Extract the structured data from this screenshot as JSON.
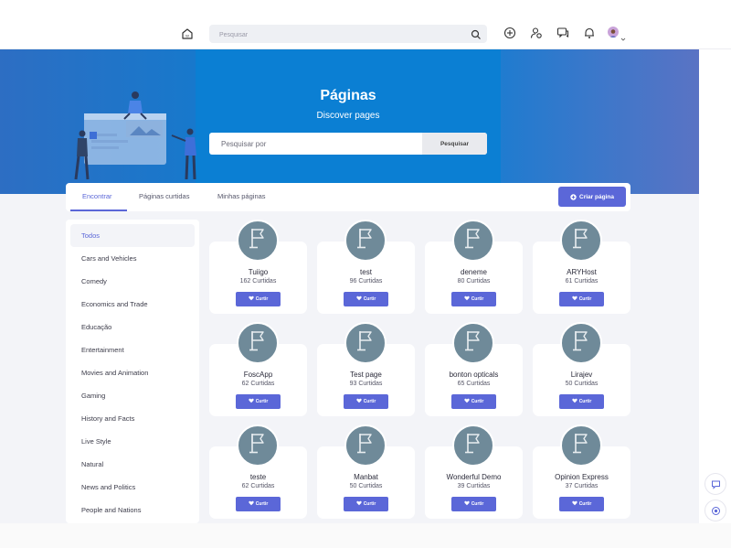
{
  "topbar": {
    "search_placeholder": "Pesquisar",
    "icons": [
      "home-icon",
      "search-icon",
      "plus-circle-icon",
      "user-settings-icon",
      "chat-icon",
      "bell-icon",
      "avatar",
      "caret-icon"
    ]
  },
  "hero": {
    "title": "Páginas",
    "subtitle": "Discover pages",
    "search_placeholder": "Pesquisar por",
    "search_button": "Pesquisar"
  },
  "tabs": [
    {
      "label": "Encontrar",
      "active": true
    },
    {
      "label": "Páginas curtidas",
      "active": false
    },
    {
      "label": "Minhas páginas",
      "active": false
    }
  ],
  "create_button": "Criar página",
  "categories": [
    "Todos",
    "Cars and Vehicles",
    "Comedy",
    "Economics and Trade",
    "Educação",
    "Entertainment",
    "Movies and Animation",
    "Gaming",
    "History and Facts",
    "Live Style",
    "Natural",
    "News and Politics",
    "People and Nations"
  ],
  "pages": [
    {
      "name": "Tuiigo",
      "likes": "162 Curtidas",
      "button": "Curtir"
    },
    {
      "name": "test",
      "likes": "96 Curtidas",
      "button": "Curtir"
    },
    {
      "name": "deneme",
      "likes": "80 Curtidas",
      "button": "Curtir"
    },
    {
      "name": "ARYHost",
      "likes": "61 Curtidas",
      "button": "Curtir"
    },
    {
      "name": "FoscApp",
      "likes": "62 Curtidas",
      "button": "Curtir"
    },
    {
      "name": "Test page",
      "likes": "93 Curtidas",
      "button": "Curtir"
    },
    {
      "name": "bonton opticals",
      "likes": "65 Curtidas",
      "button": "Curtir"
    },
    {
      "name": "Lirajev",
      "likes": "50 Curtidas",
      "button": "Curtir"
    },
    {
      "name": "teste",
      "likes": "62 Curtidas",
      "button": "Curtir"
    },
    {
      "name": "Manbat",
      "likes": "50 Curtidas",
      "button": "Curtir"
    },
    {
      "name": "Wonderful Demo",
      "likes": "39 Curtidas",
      "button": "Curtir"
    },
    {
      "name": "Opinion Express",
      "likes": "37 Curtidas",
      "button": "Curtir"
    }
  ],
  "colors": {
    "accent": "#5b67d8",
    "hero_blue": "#0b7fd3",
    "page_avatar": "#6f8a99"
  }
}
